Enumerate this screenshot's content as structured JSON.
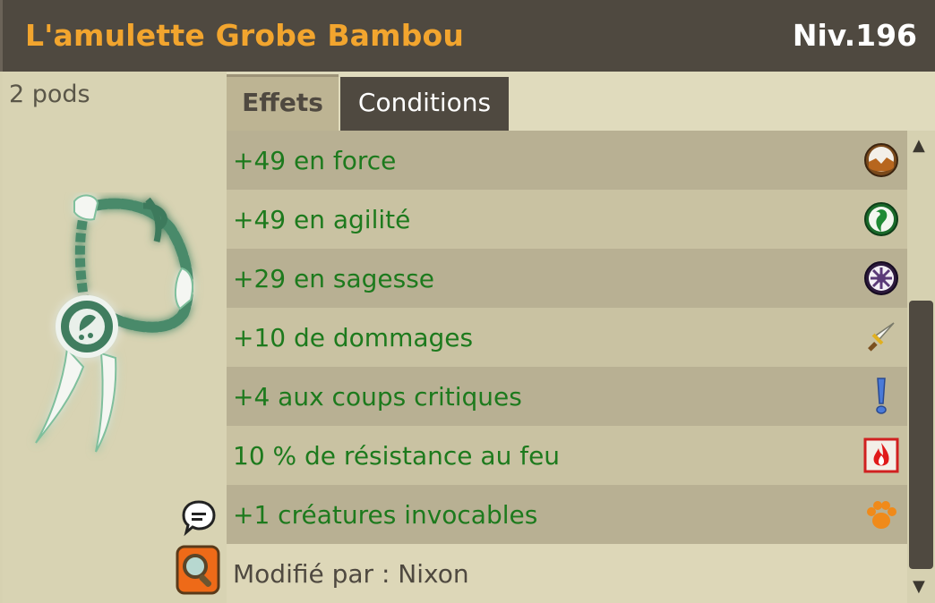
{
  "header": {
    "title": "L'amulette Grobe Bambou",
    "level": "Niv.196"
  },
  "item": {
    "weight": "2 pods",
    "image": "amulet-icon"
  },
  "tabs": [
    {
      "label": "Effets",
      "active": true
    },
    {
      "label": "Conditions",
      "active": false
    }
  ],
  "effects": [
    {
      "text": "+49 en force",
      "icon": "strength-icon"
    },
    {
      "text": "+49 en agilité",
      "icon": "agility-icon"
    },
    {
      "text": "+29 en sagesse",
      "icon": "wisdom-icon"
    },
    {
      "text": "+10 de dommages",
      "icon": "damage-sword-icon"
    },
    {
      "text": "+4 aux coups critiques",
      "icon": "critical-exclamation-icon"
    },
    {
      "text": "10 % de résistance au feu",
      "icon": "fire-resistance-icon"
    },
    {
      "text": "+1 créatures invocables",
      "icon": "summon-paw-icon"
    }
  ],
  "modified_by": "Modifié par : Nixon",
  "colors": {
    "title": "#f2a52e",
    "header_bg": "#4f4940",
    "effect_text": "#1d7a1d",
    "row_dark": "#b8b093",
    "row_light": "#c9c2a2"
  }
}
